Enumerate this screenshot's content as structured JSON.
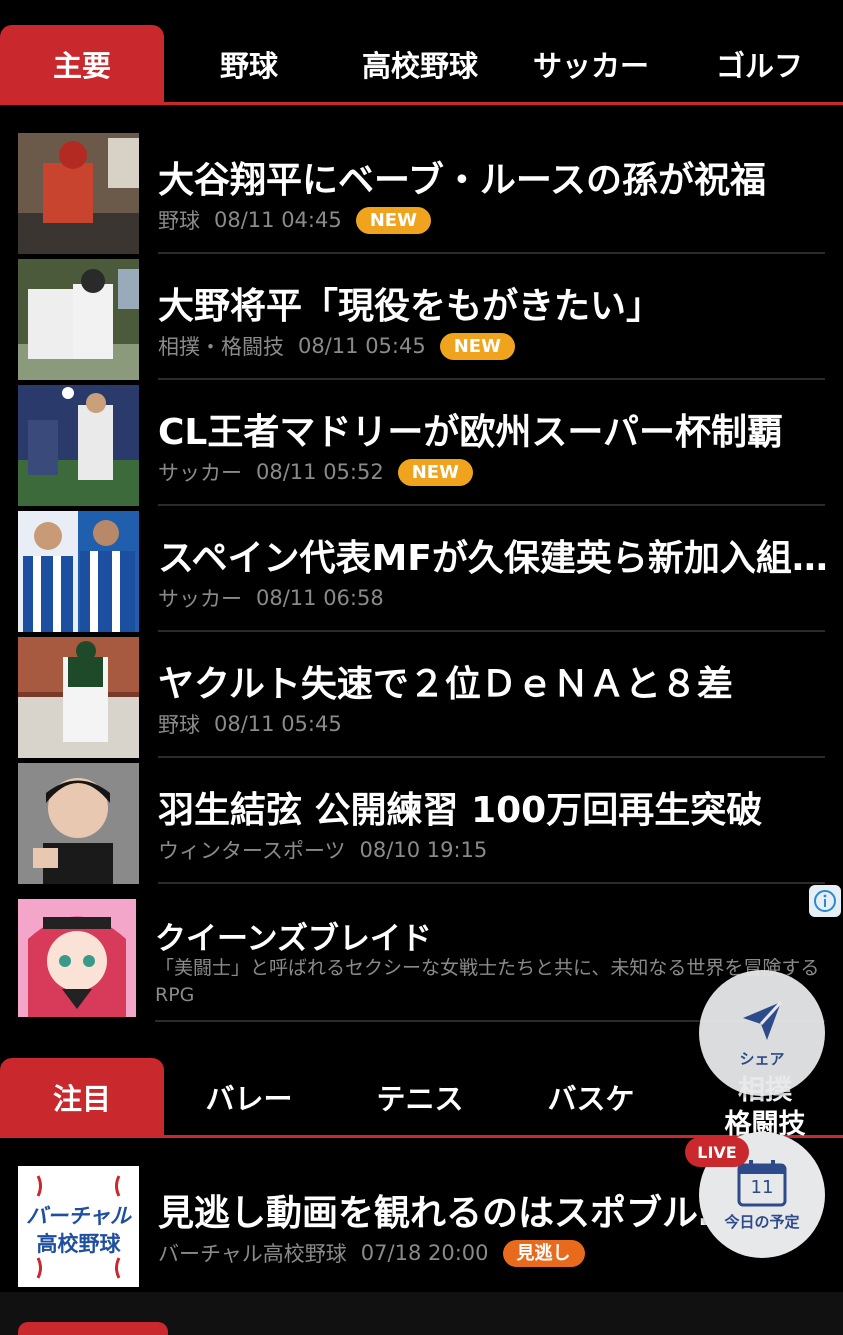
{
  "top_tabs": [
    "主要",
    "野球",
    "高校野球",
    "サッカー",
    "ゴルフ"
  ],
  "news": [
    {
      "title": "大谷翔平にベーブ・ルースの孫が祝福",
      "category": "野球",
      "time": "08/11 04:45",
      "badge": "NEW"
    },
    {
      "title": "大野将平「現役をもがきたい」",
      "category": "相撲・格闘技",
      "time": "08/11 05:45",
      "badge": "NEW"
    },
    {
      "title": "CL王者マドリーが欧州スーパー杯制覇",
      "category": "サッカー",
      "time": "08/11 05:52",
      "badge": "NEW"
    },
    {
      "title": "スペイン代表MFが久保建英ら新加入組…",
      "category": "サッカー",
      "time": "08/11 06:58",
      "badge": ""
    },
    {
      "title": "ヤクルト失速で２位ＤｅＮＡと８差",
      "category": "野球",
      "time": "08/11 05:45",
      "badge": ""
    },
    {
      "title": "羽生結弦 公開練習 100万回再生突破",
      "category": "ウィンタースポーツ",
      "time": "08/10 19:15",
      "badge": ""
    }
  ],
  "ad": {
    "title": "クイーンズブレイド",
    "description": "「美闘士」と呼ばれるセクシーな女戦士たちと共に、未知なる世界を冒険するRPG"
  },
  "second_tabs": [
    "注目",
    "バレー",
    "テニス",
    "バスケ"
  ],
  "overlap_tab": [
    "相撲",
    "格闘技"
  ],
  "featured": {
    "title": "見逃し動画を観れるのはスポブルだけ",
    "category": "バーチャル高校野球",
    "time": "07/18 20:00",
    "badge": "見逃し",
    "thumb_text": [
      "バーチャル",
      "高校野球"
    ]
  },
  "fab_share": {
    "label": "シェア"
  },
  "fab_schedule": {
    "label": "今日の予定",
    "day": "11",
    "live": "LIVE"
  },
  "colors": {
    "accent": "#c9282d",
    "new_badge": "#f0a41e",
    "miss_badge": "#e86a1d",
    "fab_icon": "#2d4a8a"
  },
  "icons": {
    "info": "info-icon",
    "share": "send-arrow-icon",
    "calendar": "calendar-icon"
  }
}
